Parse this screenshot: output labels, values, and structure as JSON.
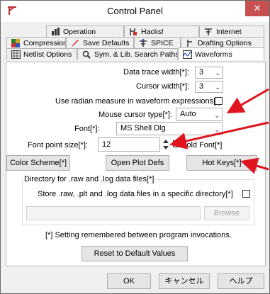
{
  "window": {
    "title": "Control Panel",
    "close_glyph": "✕"
  },
  "tabs": {
    "row1": [
      {
        "label": "Operation",
        "icon": "operation-icon"
      },
      {
        "label": "Hacks!",
        "icon": "hacks-icon"
      },
      {
        "label": "Internet",
        "icon": "internet-icon"
      }
    ],
    "row2": [
      {
        "label": "Compression",
        "icon": "compression-icon"
      },
      {
        "label": "Save Defaults",
        "icon": "pencil-icon"
      },
      {
        "label": "SPICE",
        "icon": "spice-icon"
      },
      {
        "label": "Drafting Options",
        "icon": "drafting-icon"
      }
    ],
    "row3": [
      {
        "label": "Netlist Options",
        "icon": "netlist-icon"
      },
      {
        "label": "Sym. & Lib. Search Paths",
        "icon": "search-icon"
      },
      {
        "label": "Waveforms",
        "icon": "waveforms-icon",
        "active": true
      }
    ]
  },
  "settings": {
    "data_trace_width_label": "Data trace width[*]:",
    "data_trace_width_value": "3",
    "cursor_width_label": "Cursor width[*]:",
    "cursor_width_value": "3",
    "radian_label": "Use radian measure in waveform expressions[*]",
    "mouse_cursor_type_label": "Mouse cursor type[*]:",
    "mouse_cursor_type_value": "Auto",
    "font_label": "Font[*]:",
    "font_value": "MS Shell Dlg",
    "font_point_size_label": "Font point size[*]:",
    "font_point_size_value": "12",
    "bold_font_label": "Bold Font[*]"
  },
  "buttons": {
    "color_scheme": "Color Scheme[*]",
    "open_plot_defs": "Open Plot Defs",
    "hot_keys": "Hot Keys[*]",
    "browse": "Browse",
    "reset": "Reset to Default Values",
    "ok": "OK",
    "cancel": "キャンセル",
    "help": "ヘルプ"
  },
  "group": {
    "title": "Directory for .raw and .log data files[*]",
    "store_label": "Store .raw, .plt and .log data files in a specific directory[*]",
    "directory_value": ""
  },
  "footnote": "[*] Setting remembered between program invocations.",
  "colors": {
    "close_button": "#c75050",
    "annotation_arrow": "#e0141e"
  }
}
